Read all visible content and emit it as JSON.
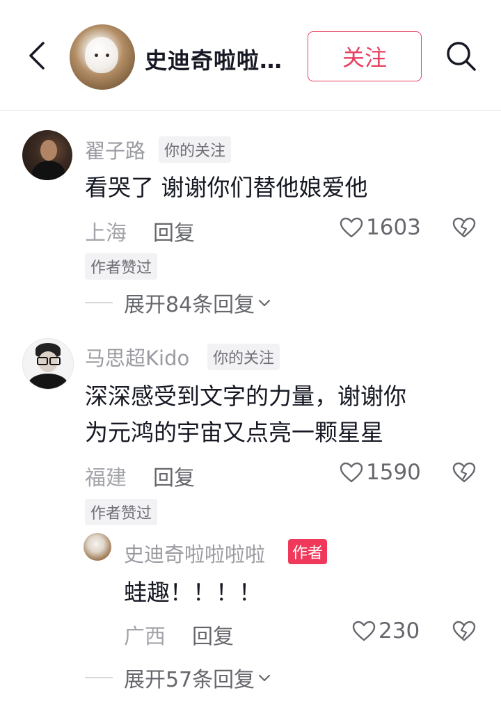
{
  "header": {
    "title": "史迪奇啦啦…",
    "follow_label": "关注"
  },
  "comments": [
    {
      "username": "翟子路",
      "tag": "你的关注",
      "text": "看哭了 谢谢你们替他娘爱他",
      "location": "上海",
      "reply_label": "回复",
      "likes": "1603",
      "liked_badge": "作者赞过",
      "expand_label": "展开84条回复"
    },
    {
      "username": "马思超Kido",
      "tag": "你的关注",
      "text_line1": "深深感受到文字的力量，谢谢你",
      "text_line2": "为元鸿的宇宙又点亮一颗星星",
      "location": "福建",
      "reply_label": "回复",
      "likes": "1590",
      "liked_badge": "作者赞过",
      "reply": {
        "username": "史迪奇啦啦啦啦",
        "author_tag": "作者",
        "text": "蛙趣！！！！",
        "location": "广西",
        "reply_label": "回复",
        "likes": "230"
      },
      "expand_label": "展开57条回复"
    }
  ],
  "colors": {
    "accent": "#e64060",
    "author_tag": "#f0385a",
    "muted": "#a4a5ab"
  }
}
